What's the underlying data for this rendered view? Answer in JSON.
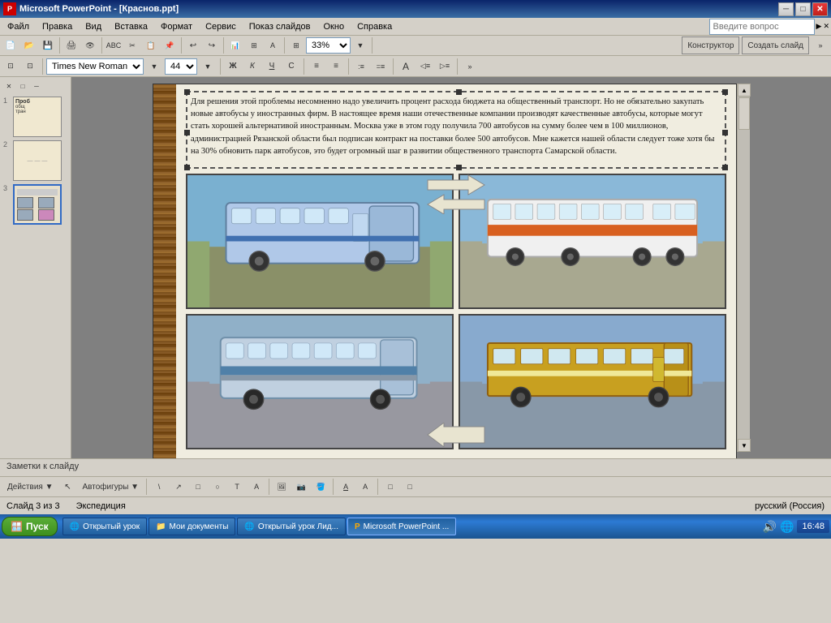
{
  "window": {
    "title": "Microsoft PowerPoint - [Краснов.ppt]",
    "icon": "PP"
  },
  "titlebar": {
    "label": "Microsoft PowerPoint - [Краснов.ppt]",
    "minimize": "─",
    "maximize": "□",
    "close": "✕"
  },
  "menubar": {
    "items": [
      "Файл",
      "Правка",
      "Вид",
      "Вставка",
      "Формат",
      "Сервис",
      "Показ слайдов",
      "Окно",
      "Справка"
    ]
  },
  "toolbar": {
    "zoom": "33%",
    "font": "Times New Roman",
    "fontsize": "44",
    "help_placeholder": "Введите вопрос",
    "konstr_label": "Конструктор",
    "create_label": "Создать слайд"
  },
  "slides": [
    {
      "num": "1",
      "preview_text": "Проб общ тран"
    },
    {
      "num": "2",
      "preview_text": ""
    },
    {
      "num": "3",
      "preview_text": "",
      "active": true
    }
  ],
  "slide3": {
    "text": "Для решения этой проблемы несомненно надо увеличить процент расхода бюджета на общественный транспорт. Но не обязательно закупать новые автобусы у иностранных фирм. В настоящее время наши отечественные компании производят качественные автобусы, которые могут стать хорошей альтернативой иностранным. Москва уже в этом году получила 700 автобусов на сумму более чем в 100 миллионов, администрацией Рязанской области был подписан контракт на поставки более 500 автобусов. Мне кажется нашей области следует тоже хотя бы на 30% обновить парк автобусов, это будет огромный шаг в развитии общественного транспорта Самарской области.",
    "images": [
      {
        "label": "Современный синий автобус слева"
      },
      {
        "label": "Белый автобус справа"
      },
      {
        "label": "Синий автобус снизу слева"
      },
      {
        "label": "Желтый старый автобус снизу справа"
      }
    ]
  },
  "notes": {
    "label": "Заметки к слайду"
  },
  "statusbar": {
    "slide_info": "Слайд 3 из 3",
    "theme": "Экспедиция",
    "lang": "русский (Россия)"
  },
  "bottomtoolbar": {
    "actions": "Действия ▼",
    "autoshapes": "Автофигуры ▼"
  },
  "taskbar": {
    "start": "Пуск",
    "items": [
      {
        "label": "Открытый урок",
        "icon": "🌐",
        "active": false
      },
      {
        "label": "Мои документы",
        "icon": "📁",
        "active": false
      },
      {
        "label": "Открытый урок Лид...",
        "icon": "🌐",
        "active": false
      },
      {
        "label": "Microsoft PowerPoint ...",
        "icon": "P",
        "active": true
      }
    ],
    "time": "16:48"
  }
}
